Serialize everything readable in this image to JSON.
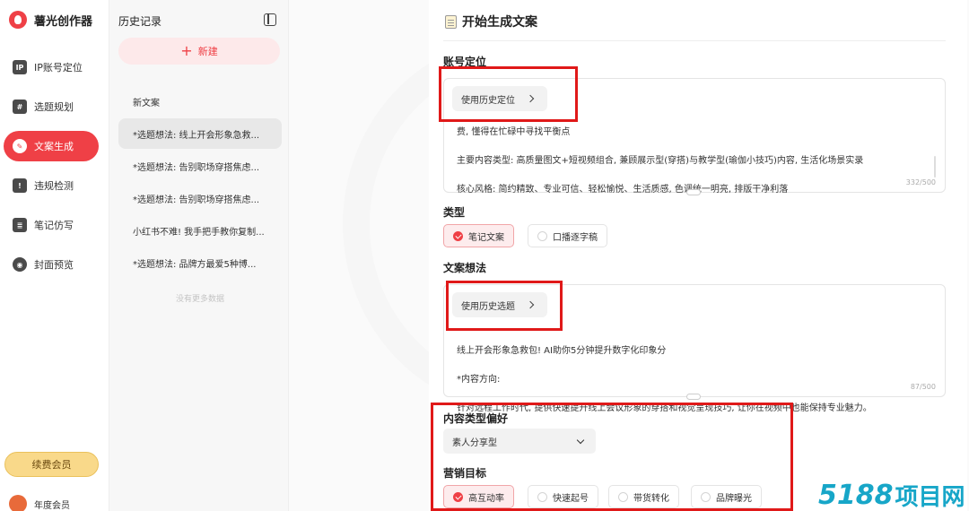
{
  "brand": {
    "name": "薯光创作器"
  },
  "nav": {
    "items": [
      {
        "label": "IP账号定位",
        "icon": "ip-icon",
        "glyph": "IP",
        "active": false
      },
      {
        "label": "选题规划",
        "icon": "hashtag-icon",
        "glyph": "#",
        "active": false
      },
      {
        "label": "文案生成",
        "icon": "copywriting-icon",
        "glyph": "✎",
        "active": true
      },
      {
        "label": "违规检测",
        "icon": "alert-icon",
        "glyph": "!",
        "active": false
      },
      {
        "label": "笔记仿写",
        "icon": "note-icon",
        "glyph": "≣",
        "active": false
      },
      {
        "label": "封面预览",
        "icon": "eye-icon",
        "glyph": "◉",
        "active": false
      }
    ],
    "renew_label": "续费会员",
    "member_label": "年度会员"
  },
  "history": {
    "title": "历史记录",
    "new_label": "新建",
    "items": [
      "新文案",
      "*选题想法: 线上开会形象急救...",
      "*选题想法: 告别职场穿搭焦虑...",
      "*选题想法: 告别职场穿搭焦虑...",
      "小红书不难! 我手把手教你复制...",
      "*选题想法: 品牌方最爱5种博..."
    ],
    "selected_index": 1,
    "no_more": "没有更多数据"
  },
  "main": {
    "title": "开始生成文案",
    "account": {
      "label": "账号定位",
      "history_button": "使用历史定位",
      "lines": [
        "费, 懂得在忙碌中寻找平衡点",
        "主要内容类型: 高质量图文+短视频组合, 兼顾展示型(穿搭)与教学型(瑜伽小技巧)内容, 生活化场景实录",
        "核心风格: 简约精致、专业可信、轻松愉悦、生活质感, 色调统一明亮, 排版干净利落"
      ],
      "counter": "332/500"
    },
    "type": {
      "label": "类型",
      "options": [
        {
          "label": "笔记文案",
          "selected": true
        },
        {
          "label": "口播逐字稿",
          "selected": false
        }
      ]
    },
    "idea": {
      "label": "文案想法",
      "history_button": "使用历史选题",
      "lines": [
        "线上开会形象急救包! AI助你5分钟提升数字化印象分",
        "*内容方向:",
        "针对远程工作时代, 提供快速提升线上会议形象的穿搭和视觉呈现技巧, 让你在视频中也能保持专业魅力。"
      ],
      "counter": "87/500"
    },
    "preference": {
      "label": "内容类型偏好",
      "selected": "素人分享型"
    },
    "goal": {
      "label": "营销目标",
      "options": [
        {
          "label": "高互动率",
          "selected": true
        },
        {
          "label": "快速起号",
          "selected": false
        },
        {
          "label": "带货转化",
          "selected": false
        },
        {
          "label": "品牌曝光",
          "selected": false
        }
      ]
    }
  },
  "watermark": {
    "num": "5188",
    "cn": "项目网"
  },
  "colors": {
    "accent": "#ef4046",
    "annotation": "#e01919",
    "renew": "#f9d98a",
    "watermark": "#17a6c8"
  }
}
